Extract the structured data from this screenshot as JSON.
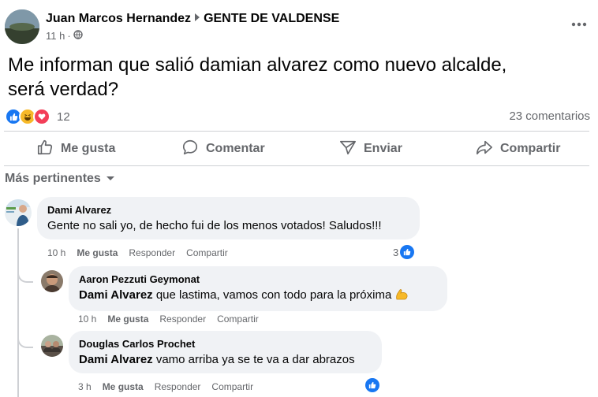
{
  "post": {
    "author": "Juan Marcos Hernandez",
    "group": "GENTE DE VALDENSE",
    "time": "11 h",
    "separator": "·",
    "text_line1": "Me informan que salió damian alvarez como nuevo alcalde,",
    "text_line2": "será verdad?",
    "reaction_count": "12",
    "comments_count": "23 comentarios"
  },
  "actions": {
    "like": "Me gusta",
    "comment": "Comentar",
    "send": "Enviar",
    "share": "Compartir"
  },
  "sort_label": "Más pertinentes",
  "comments": [
    {
      "name": "Dami Alvarez",
      "text": "Gente no sali yo, de hecho fui de los menos votados! Saludos!!!",
      "time": "10 h",
      "like": "Me gusta",
      "reply": "Responder",
      "share": "Compartir",
      "reactions": "3"
    }
  ],
  "replies": [
    {
      "name": "Aaron Pezzuti Geymonat",
      "mention": "Dami Alvarez",
      "text": " que lastima, vamos con todo para la próxima ",
      "time": "10 h",
      "like": "Me gusta",
      "reply": "Responder",
      "share": "Compartir"
    },
    {
      "name": "Douglas Carlos Prochet",
      "mention": "Dami Alvarez",
      "text": " vamo arriba ya se te va a dar abrazos",
      "time": "3 h",
      "like": "Me gusta",
      "reply": "Responder",
      "share": "Compartir"
    }
  ],
  "icons": {
    "globe": "globe-icon",
    "more": "more-options-icon",
    "like": "thumbs-up-icon",
    "comment": "comment-bubble-icon",
    "send": "send-icon",
    "share": "share-arrow-icon",
    "chevron": "chevron-down-icon",
    "muscle": "flexed-biceps-emoji"
  },
  "colors": {
    "like_blue": "#1877f2",
    "haha_yellow": "#f7b928",
    "love_red": "#f33e58",
    "muted_text": "#65676b",
    "bubble_bg": "#f0f2f5"
  }
}
